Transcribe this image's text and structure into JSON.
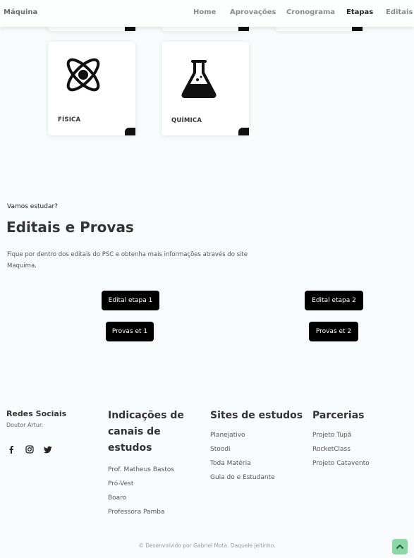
{
  "navbar": {
    "brand": "Máquina",
    "links": [
      "Home",
      "Aprovações",
      "Cronograma",
      "Etapas",
      "Editais"
    ],
    "active": "Etapas"
  },
  "subjects": {
    "cards": [
      {
        "label": "FÍSICA",
        "icon": "atom-icon"
      },
      {
        "label": "QUÍMICA",
        "icon": "flask-icon"
      }
    ]
  },
  "editais": {
    "eyebrow": "Vamos estudar?",
    "title": "Editais e Provas",
    "description": "Fique por dentro dos editais do PSC e obtenha mais informações através do site Maquima.",
    "buttons": {
      "edital1": "Edital etapa 1",
      "edital2": "Edital etapa 2",
      "provas1": "Provas et 1",
      "provas2": "Provas et 2"
    }
  },
  "footer": {
    "social": {
      "title": "Redes Sociais",
      "subtitle": "Doutor Artur.",
      "icons": [
        "facebook-icon",
        "instagram-icon",
        "twitter-icon"
      ]
    },
    "channels": {
      "title": "Indicações de canais de estudos",
      "items": [
        "Prof. Matheus Bastos",
        "Pró-Vest",
        "Boaro",
        "Professora Pamba"
      ]
    },
    "sites": {
      "title": "Sites de estudos",
      "items": [
        "Planejativo",
        "Stoodi",
        "Toda Matéria",
        "Guia do e Estudante"
      ]
    },
    "partners": {
      "title": "Parcerias",
      "items": [
        "Projeto Tupã",
        "RocketClass",
        "Projeto Catavento"
      ]
    },
    "copyright": "© Desenvolvido por Gabriel Mota. Daquele jeitinho."
  },
  "colors": {
    "background": "#f8fbfb",
    "button": "#000000",
    "scroll_top": "#8fd6a6"
  }
}
